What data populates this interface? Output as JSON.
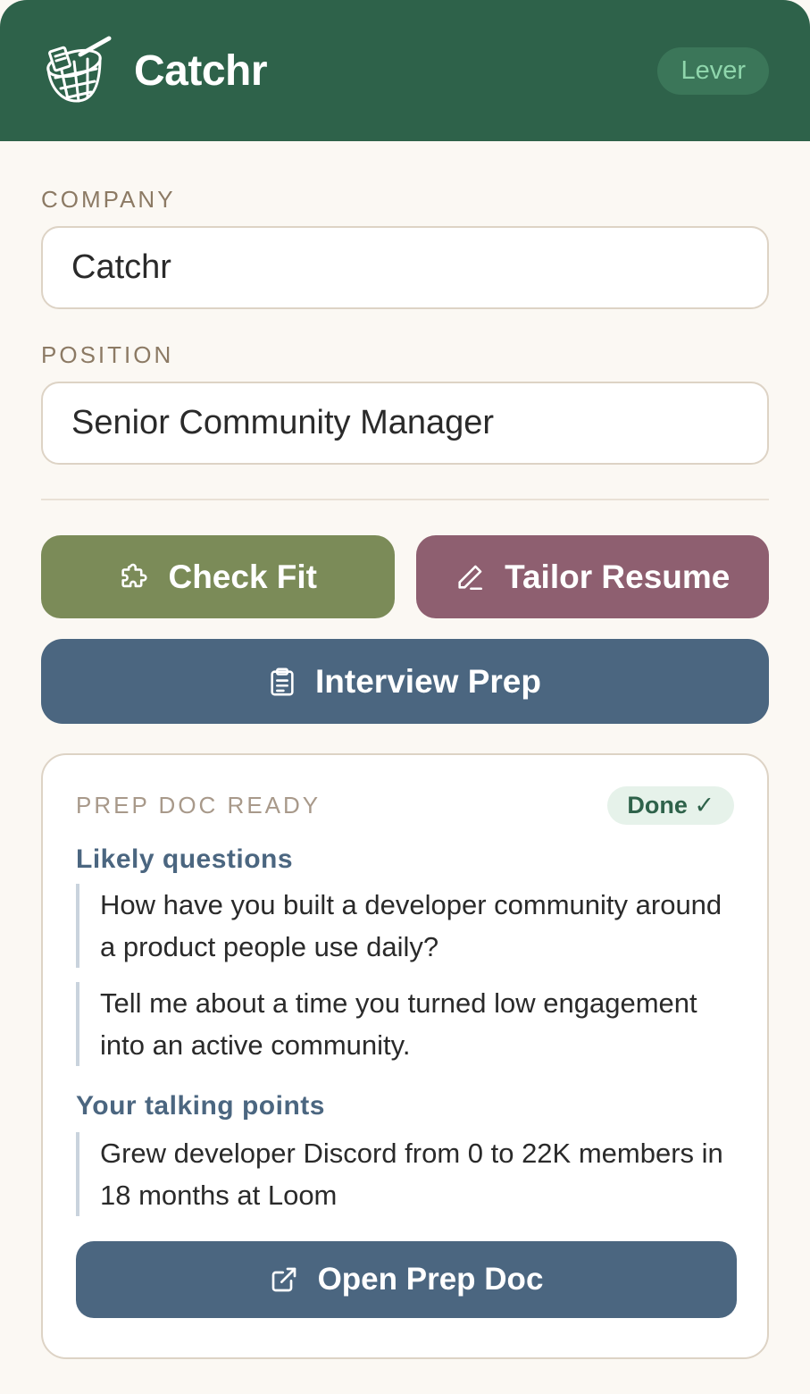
{
  "header": {
    "app_name": "Catchr",
    "source_badge": "Lever"
  },
  "form": {
    "company_label": "COMPANY",
    "company_value": "Catchr",
    "position_label": "POSITION",
    "position_value": "Senior Community Manager"
  },
  "actions": {
    "check_fit": "Check Fit",
    "tailor_resume": "Tailor Resume",
    "interview_prep": "Interview Prep"
  },
  "prep_doc": {
    "title": "PREP DOC READY",
    "status": "Done ✓",
    "questions_heading": "Likely questions",
    "questions": [
      "How have you built a developer community around a product people use daily?",
      "Tell me about a time you turned low engagement into an active community."
    ],
    "points_heading": "Your talking points",
    "points": [
      "Grew developer Discord from 0 to 22K members in 18 months at Loom"
    ],
    "open_button": "Open Prep Doc"
  },
  "colors": {
    "header_bg": "#2e624a",
    "check_fit": "#7b8b58",
    "tailor_resume": "#8e5f70",
    "interview_prep": "#4b6680",
    "background": "#fbf8f3"
  },
  "icons": {
    "logo": "net-logo-icon",
    "check_fit": "puzzle-icon",
    "tailor_resume": "pencil-icon",
    "interview_prep": "clipboard-icon",
    "open_doc": "external-link-icon"
  }
}
